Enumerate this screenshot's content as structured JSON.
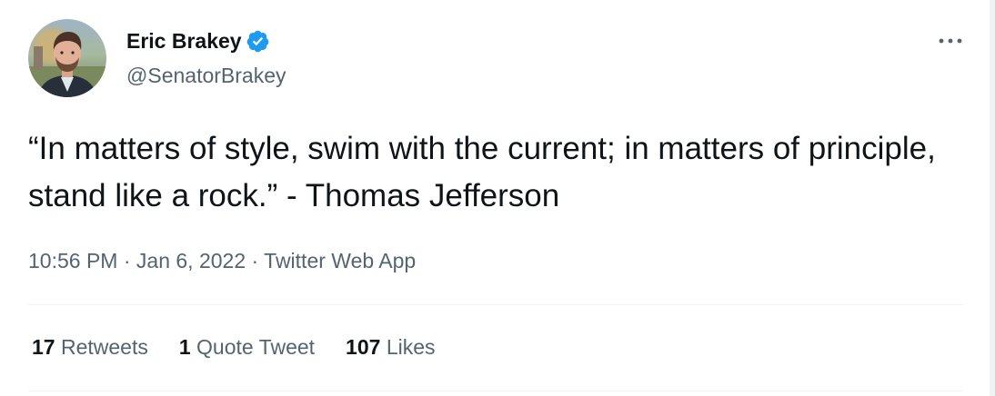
{
  "author": {
    "display_name": "Eric Brakey",
    "handle": "@SenatorBrakey",
    "verified": true
  },
  "tweet": {
    "text": "“In matters of style, swim with the current; in matters of principle, stand like a rock.” - Thomas Jefferson",
    "time": "10:56 PM",
    "separator": "·",
    "date": "Jan 6, 2022",
    "source": "Twitter Web App"
  },
  "stats": {
    "retweets_count": "17",
    "retweets_label": "Retweets",
    "quotes_count": "1",
    "quotes_label": "Quote Tweet",
    "likes_count": "107",
    "likes_label": "Likes"
  },
  "icons": {
    "verified": "verified-badge-icon",
    "more": "more-options-icon"
  },
  "colors": {
    "text": "#0f1419",
    "secondary": "#536471",
    "verified": "#1d9bf0",
    "divider": "#eff3f4"
  }
}
